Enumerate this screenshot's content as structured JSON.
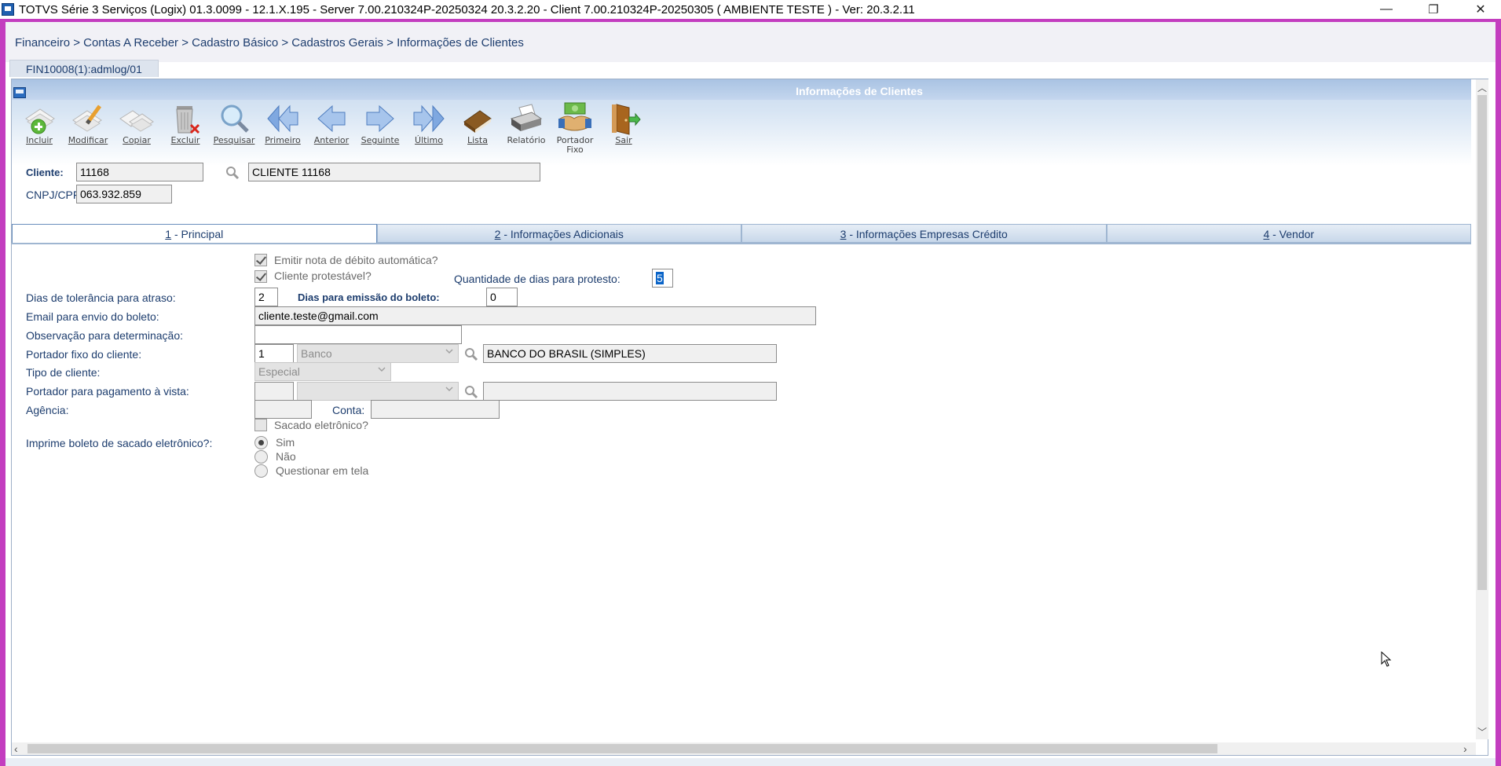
{
  "window": {
    "title": "TOTVS Série 3 Serviços (Logix) 01.3.0099  -  12.1.X.195 - Server 7.00.210324P-20250324 20.3.2.20 - Client 7.00.210324P-20250305    ( AMBIENTE TESTE )  - Ver: 20.3.2.11",
    "minimize": "—",
    "restore": "❐",
    "close": "✕"
  },
  "breadcrumb": "Financeiro > Contas A Receber > Cadastro Básico > Cadastros Gerais > Informações de Clientes",
  "program_tab": "FIN10008(1):admlog/01",
  "form": {
    "title": "Informações de Clientes"
  },
  "toolbar": [
    {
      "label": "Incluir",
      "icon": "add-document-icon"
    },
    {
      "label": "Modificar",
      "icon": "edit-document-icon"
    },
    {
      "label": "Copiar",
      "icon": "copy-document-icon"
    },
    {
      "label": "Excluir",
      "icon": "trash-delete-icon"
    },
    {
      "label": "Pesquisar",
      "icon": "magnifier-icon"
    },
    {
      "label": "Primeiro",
      "icon": "first-arrow-icon"
    },
    {
      "label": "Anterior",
      "icon": "previous-arrow-icon"
    },
    {
      "label": "Seguinte",
      "icon": "next-arrow-icon"
    },
    {
      "label": "Último",
      "icon": "last-arrow-icon"
    },
    {
      "label": "Lista",
      "icon": "book-list-icon"
    },
    {
      "label": "Relatório",
      "icon": "printer-icon"
    },
    {
      "label": "Portador",
      "label2": "Fixo",
      "icon": "handshake-icon"
    },
    {
      "label": "Sair",
      "icon": "exit-door-icon"
    }
  ],
  "header_fields": {
    "cliente_label": "Cliente:",
    "cliente_code": "11168",
    "cliente_name": "CLIENTE 11168",
    "cnpj_label": "CNPJ/CPF:",
    "cnpj_value": "063.932.859"
  },
  "tabs": [
    {
      "key": "1",
      "rest": " - Principal",
      "active": true
    },
    {
      "key": "2",
      "rest": " - Informações Adicionais",
      "active": false
    },
    {
      "key": "3",
      "rest": " - Informações Empresas Crédito",
      "active": false
    },
    {
      "key": "4",
      "rest": " - Vendor",
      "active": false
    }
  ],
  "principal": {
    "emitir_nota_label": "Emitir nota de débito automática?",
    "emitir_nota_checked": true,
    "cliente_protestavel_label": "Cliente protestável?",
    "cliente_protestavel_checked": true,
    "qtd_dias_protesto_label": "Quantidade de dias para protesto:",
    "qtd_dias_protesto_value": "5",
    "dias_tolerancia_label": "Dias de tolerância para atraso:",
    "dias_tolerancia_value": "2",
    "dias_emissao_label": "Dias para emissão do boleto:",
    "dias_emissao_value": "0",
    "email_label": "Email para envio do boleto:",
    "email_value": "cliente.teste@gmail.com",
    "observacao_label": "Observação para determinação:",
    "observacao_value": "",
    "portador_fixo_label": "Portador fixo do cliente:",
    "portador_fixo_code": "1",
    "portador_fixo_type": "Banco",
    "portador_fixo_name": "BANCO DO BRASIL (SIMPLES)",
    "tipo_cliente_label": "Tipo de cliente:",
    "tipo_cliente_value": "Especial",
    "portador_vista_label": "Portador para pagamento à vista:",
    "portador_vista_code": "",
    "portador_vista_type": "",
    "portador_vista_name": "",
    "agencia_label": "Agência:",
    "agencia_value": "",
    "conta_label": "Conta:",
    "conta_value": "",
    "sacado_label": "Sacado eletrônico?",
    "sacado_checked": false,
    "imprime_label": "Imprime boleto de sacado eletrônico?:",
    "imprime_options": [
      "Sim",
      "Não",
      "Questionar em tela"
    ],
    "imprime_selected": "Sim"
  },
  "colors": {
    "titlebar_accent": "#c33dbf",
    "label_text": "#1d3d6e",
    "header_gradient_top": "#a9c3e3"
  }
}
